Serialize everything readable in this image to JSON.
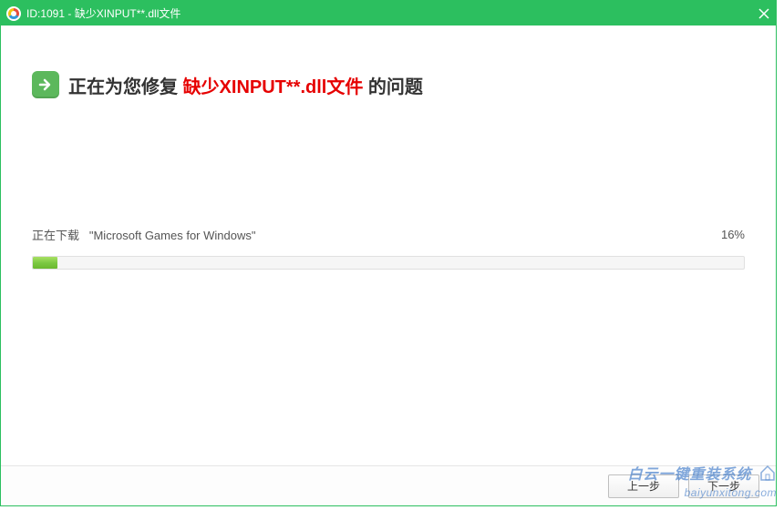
{
  "titlebar": {
    "title": "ID:1091 - 缺少XINPUT**.dll文件"
  },
  "heading": {
    "prefix": "正在为您修复",
    "highlight": "缺少XINPUT**.dll文件",
    "suffix": "的问题"
  },
  "download": {
    "prefix": "正在下载",
    "item": "\"Microsoft Games for Windows\"",
    "percent_label": "16%",
    "percent_value": 16
  },
  "footer": {
    "prev_label": "上一步",
    "next_label": "下一步"
  },
  "watermark": {
    "line1": "白云一键重装系统",
    "line2": "baiyunxitong.com"
  },
  "colors": {
    "accent": "#2cbf5f",
    "danger_text": "#e60000"
  }
}
